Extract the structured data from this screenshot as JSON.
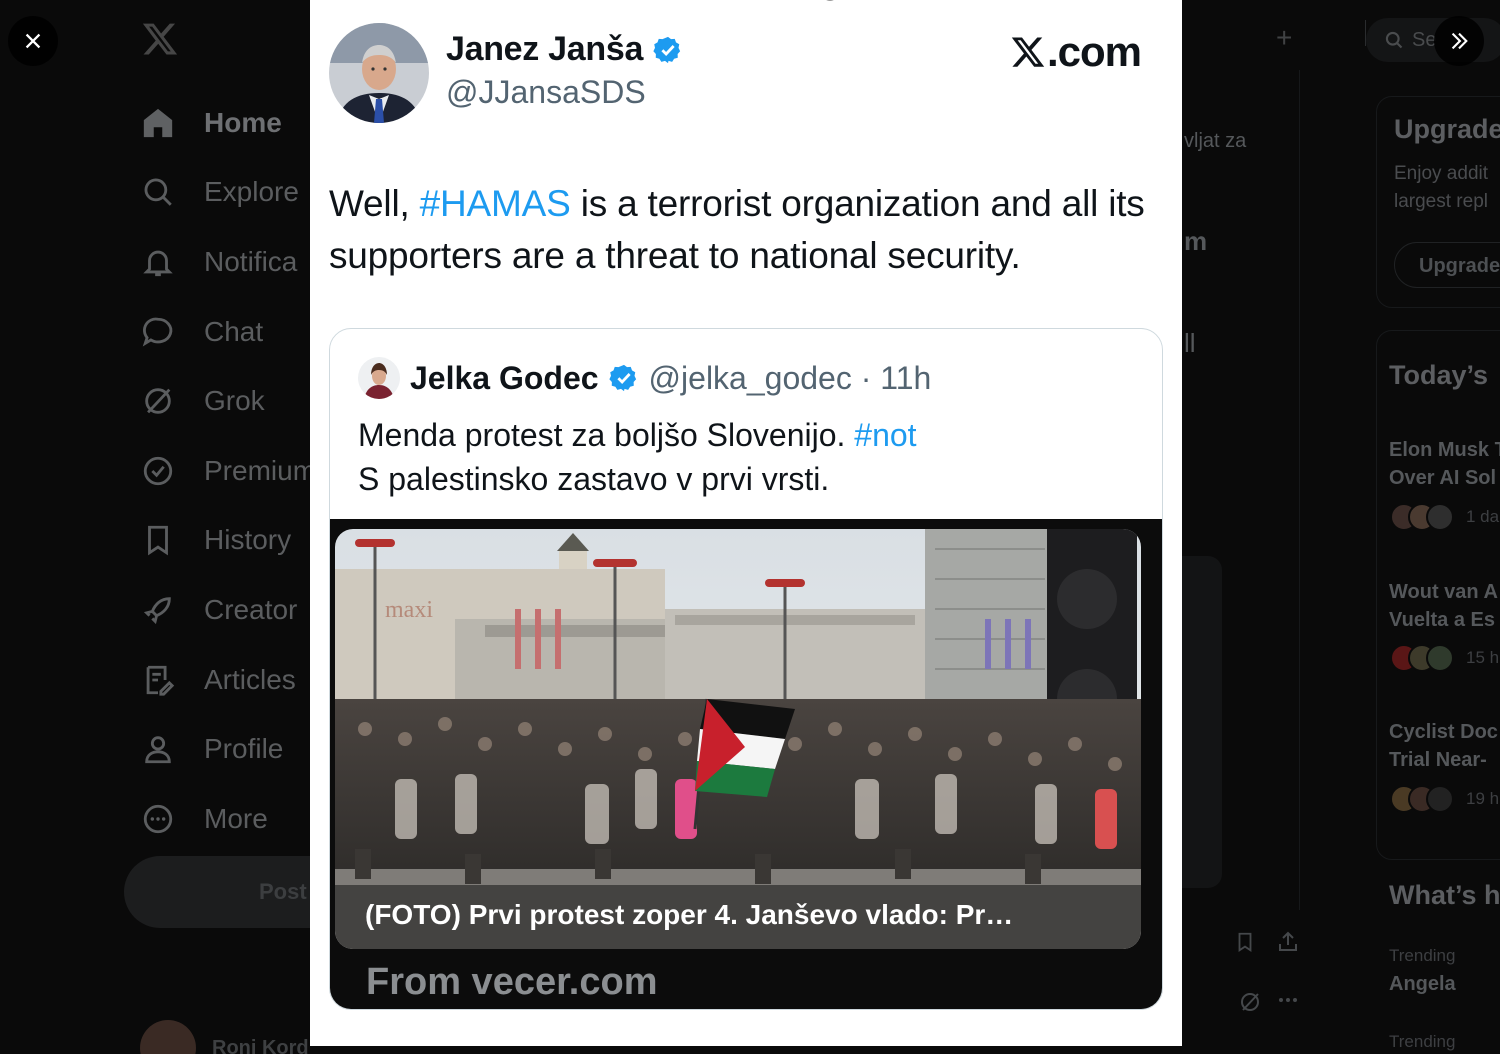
{
  "background_app": {
    "nav": [
      {
        "label": "Home",
        "icon": "home-icon"
      },
      {
        "label": "Explore",
        "icon": "search-icon"
      },
      {
        "label": "Notifica",
        "icon": "bell-icon"
      },
      {
        "label": "Chat",
        "icon": "chat-icon"
      },
      {
        "label": "Grok",
        "icon": "grok-icon"
      },
      {
        "label": "Premium",
        "icon": "premium-icon"
      },
      {
        "label": "History",
        "icon": "bookmark-icon"
      },
      {
        "label": "Creator",
        "icon": "rocket-icon"
      },
      {
        "label": "Articles",
        "icon": "articles-icon"
      },
      {
        "label": "Profile",
        "icon": "person-icon"
      },
      {
        "label": "More",
        "icon": "more-icon"
      }
    ],
    "post_button": "Post",
    "account_name": "Roni Kord",
    "search_placeholder": "Se",
    "middle_fragments": {
      "line1": "vljat za",
      "line2": "m",
      "line3": "ll"
    },
    "right": {
      "upgrade_title": "Upgrade",
      "upgrade_line1": "Enjoy addit",
      "upgrade_line2": "largest repl",
      "upgrade_button": "Upgrade",
      "today_title": "Today’s",
      "news": [
        {
          "line1": "Elon Musk T",
          "line2": "Over AI Sol",
          "time": "1 da"
        },
        {
          "line1": "Wout van A",
          "line2": "Vuelta a Es",
          "time": "15 h"
        },
        {
          "line1": "Cyclist Doc",
          "line2": "Trial Near-",
          "time": "19 h"
        }
      ],
      "whats_title": "What’s h",
      "trending": [
        {
          "label": "Trending",
          "topic": "Angela"
        },
        {
          "label": "Trending",
          "topic": ""
        }
      ]
    }
  },
  "overlay": {
    "close_icon": "close-icon",
    "expand_icon": "double-chevron-right-icon"
  },
  "tweet": {
    "author_name": "Janez Janša",
    "author_handle": "@JJansaSDS",
    "watermark": ".com",
    "text_before": "Well, ",
    "hashtag": "#HAMAS",
    "text_after": " is a terrorist organization and all its supporters are a threat to national security.",
    "quote": {
      "author_name": "Jelka Godec",
      "meta": "@jelka_godec · 11h",
      "line1_before": "Menda protest za boljšo Slovenijo. ",
      "line1_tag": "#not",
      "line2": "S palestinsko zastavo v prvi vrsti.",
      "link_caption": "(FOTO) Prvi protest zoper 4. Janševo vlado: Pr…",
      "link_source": "From vecer.com",
      "photo_sign": "maxi"
    }
  },
  "colors": {
    "link_blue": "#1d9bf0",
    "verified_blue": "#1d9bf0",
    "card_bg": "#ffffff",
    "page_bg": "#0a0a0a"
  }
}
